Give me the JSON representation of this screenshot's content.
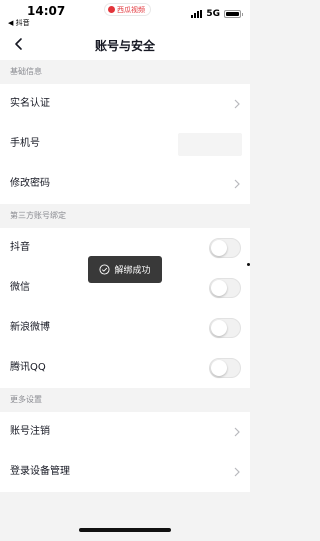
{
  "status_bar": {
    "time": "14:07",
    "back_app": "◀ 抖音",
    "badge": "西瓜视频",
    "network": "5G"
  },
  "nav": {
    "title": "账号与安全"
  },
  "sections": {
    "basic": "基础信息",
    "third_party": "第三方账号绑定",
    "more": "更多设置"
  },
  "rows": {
    "real_name": "实名认证",
    "phone": "手机号",
    "change_password": "修改密码",
    "douyin": "抖音",
    "wechat": "微信",
    "weibo": "新浪微博",
    "qq": "腾讯QQ",
    "deactivate": "账号注销",
    "device_management": "登录设备管理"
  },
  "toggles": {
    "douyin": false,
    "wechat": false,
    "weibo": false,
    "qq": false
  },
  "toast": {
    "message": "解绑成功"
  },
  "colors": {
    "background": "#f3f3f3",
    "row_background": "#ffffff",
    "section_text": "#8a8b91",
    "text": "#161823",
    "toast_background": "#282828",
    "badge_red": "#e2343a"
  }
}
